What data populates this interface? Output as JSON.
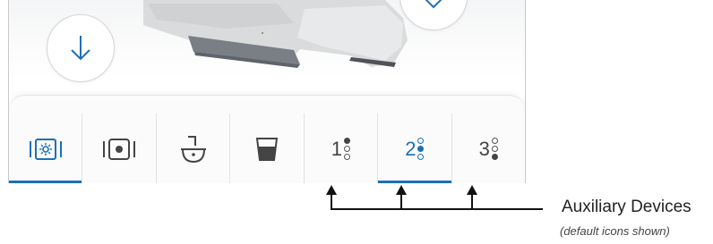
{
  "tabbar": {
    "tabs": [
      {
        "kind": "icon",
        "icon": "light-on-icon",
        "selected": true
      },
      {
        "kind": "icon",
        "icon": "light-off-icon",
        "selected": false
      },
      {
        "kind": "icon",
        "icon": "cuspidor-icon",
        "selected": false
      },
      {
        "kind": "icon",
        "icon": "cup-fill-icon",
        "selected": false
      },
      {
        "kind": "aux",
        "number": "1",
        "filled_dot": 1,
        "selected": false
      },
      {
        "kind": "aux",
        "number": "2",
        "filled_dot": 2,
        "selected": true
      },
      {
        "kind": "aux",
        "number": "3",
        "filled_dot": 3,
        "selected": false
      }
    ]
  },
  "callout": {
    "title": "Auxiliary Devices",
    "subtitle": "(default icons shown)"
  },
  "colors": {
    "accent": "#1d6fb8",
    "icon": "#444444",
    "line": "#111111"
  }
}
